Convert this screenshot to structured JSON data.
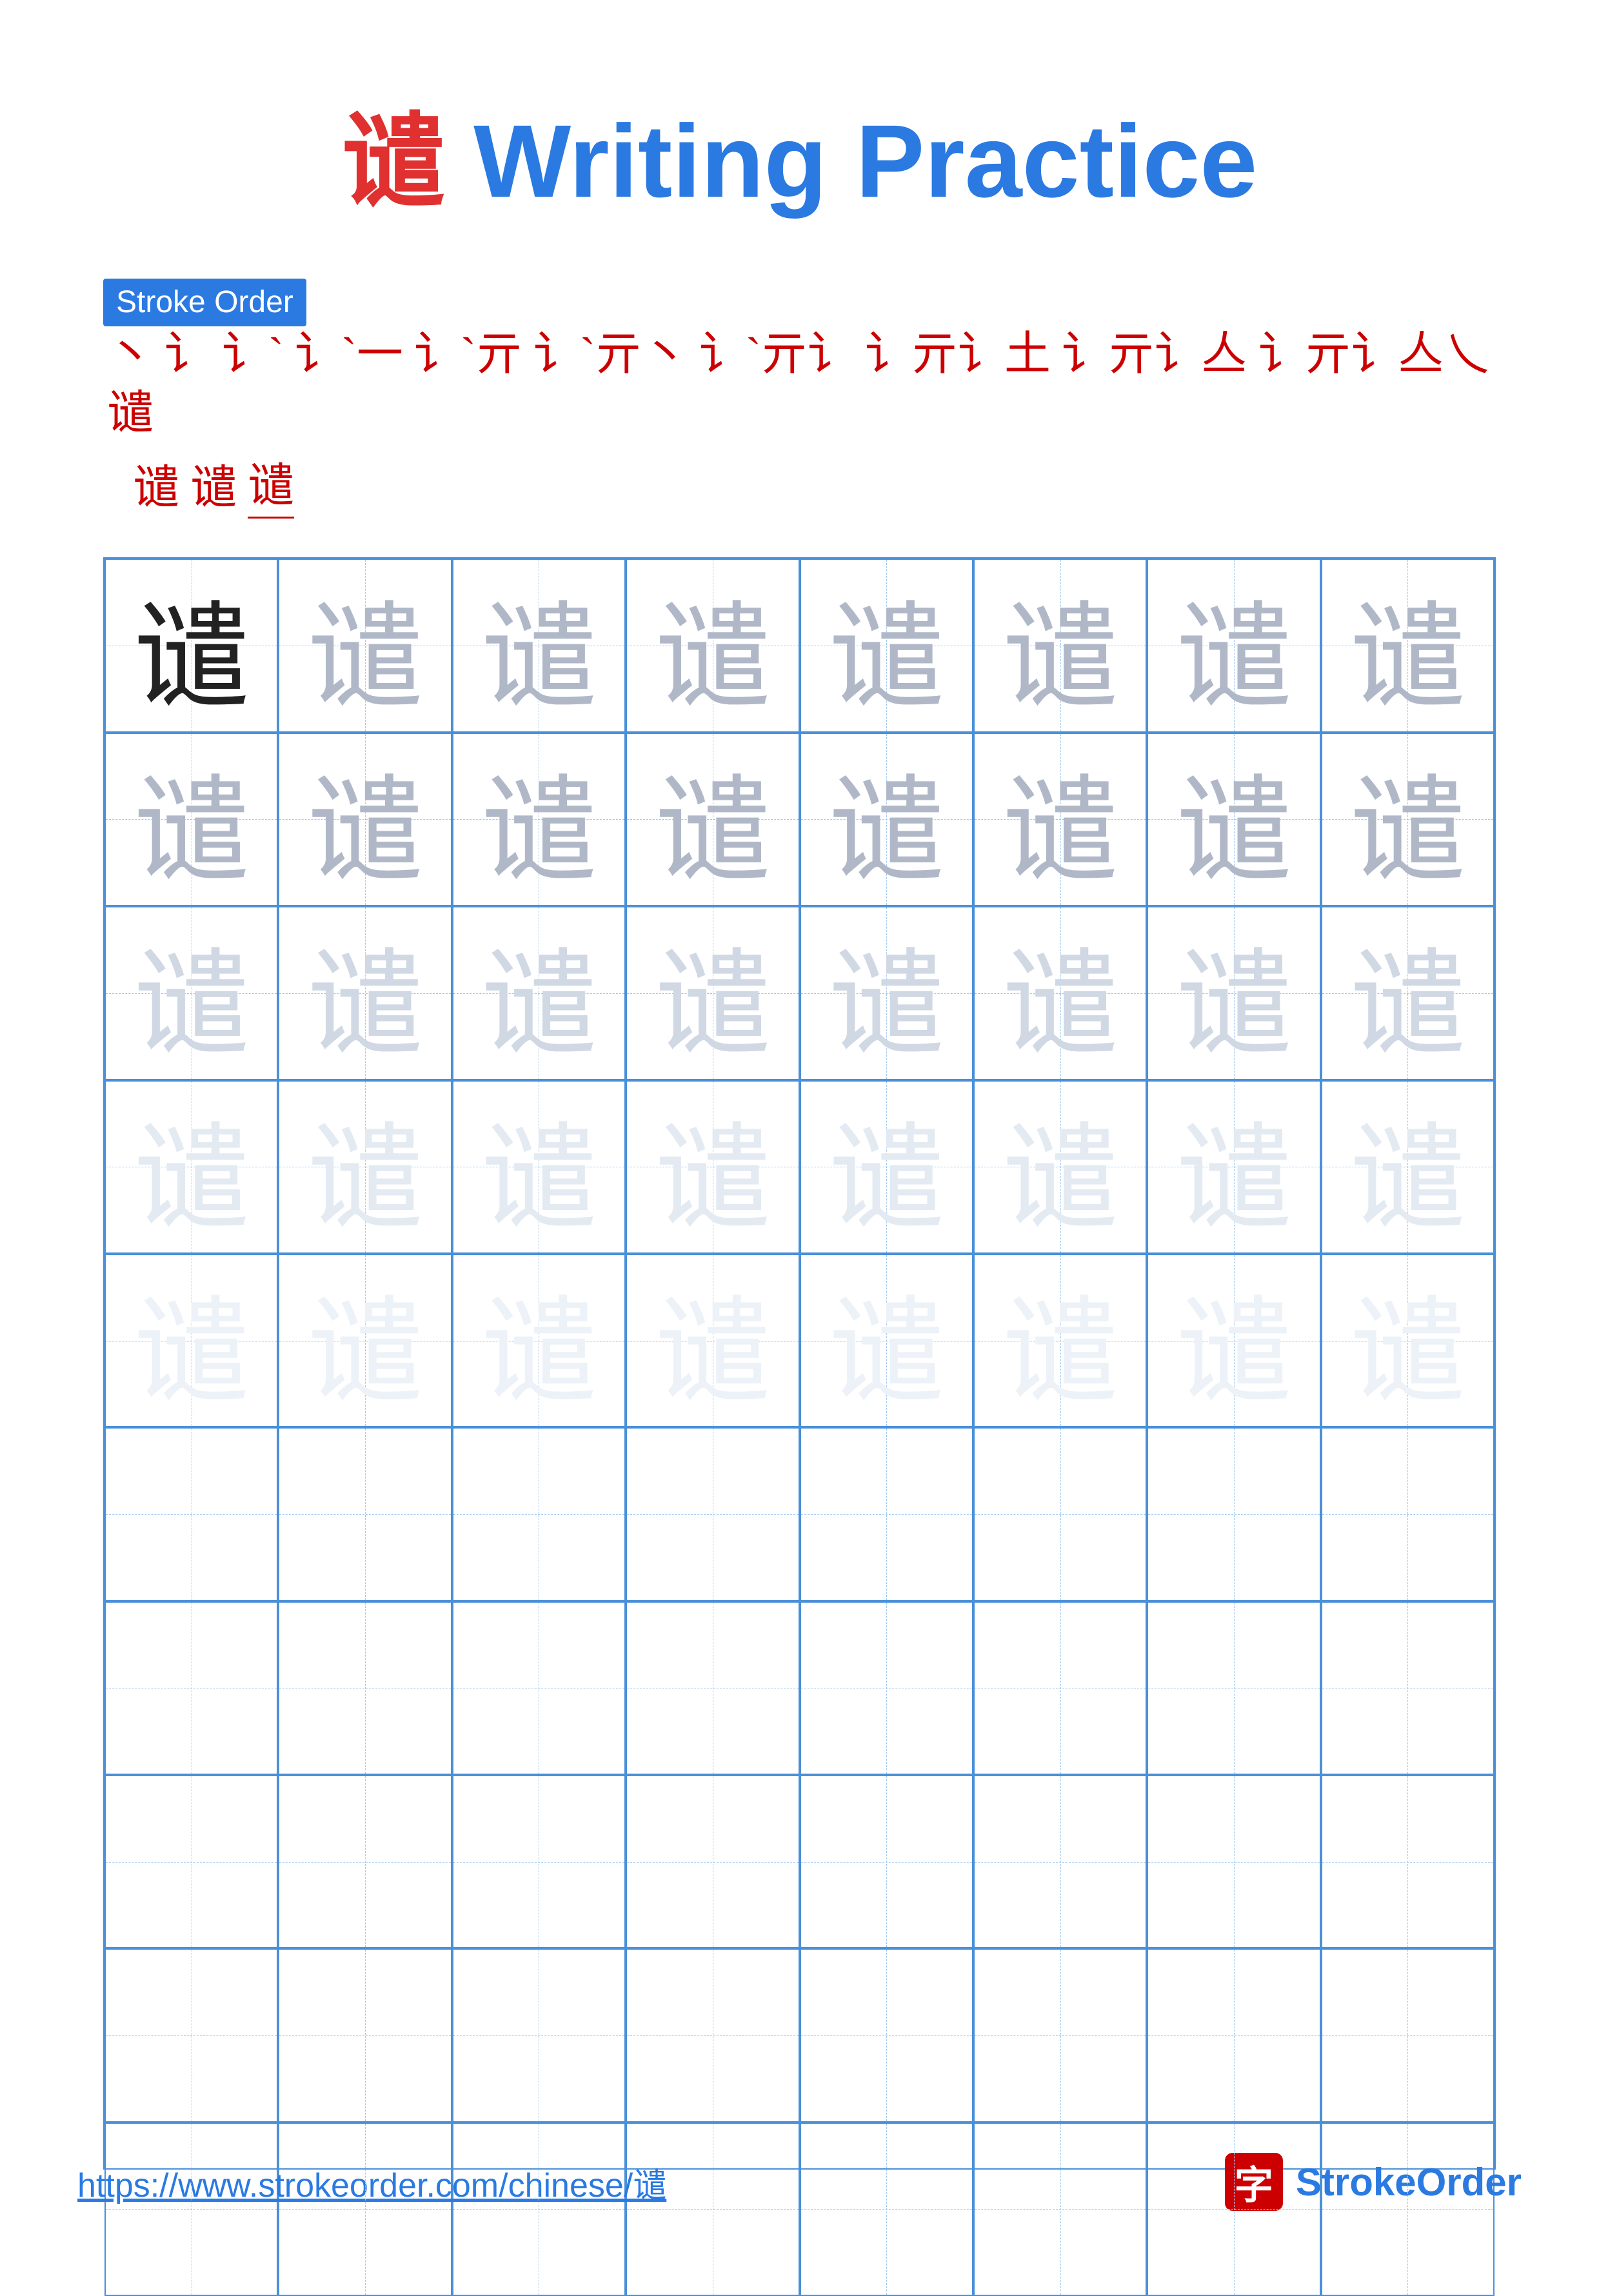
{
  "title": {
    "char": "谴",
    "rest": " Writing Practice"
  },
  "stroke_order": {
    "label": "Stroke Order",
    "strokes": [
      "丶",
      "讠",
      "讠̀",
      "讠̀一",
      "讠̀亓",
      "讠̀亓丶",
      "讠̀亓讠",
      "讠̀亓讠土",
      "讠̀亓讠亼",
      "讠̀亓讠亼乀",
      "谴",
      "谴谴",
      "谴谴谴"
    ],
    "stroke_chars_line1": [
      "丶",
      "讠",
      "讠`",
      "讠`一",
      "讠亓",
      "讠亓丶",
      "讠亓讠",
      "讠亓讠土",
      "讠亓讠亼",
      "讠亓讠亼乀",
      "谴"
    ],
    "stroke_chars_line2": [
      "谴",
      "谴",
      "谴"
    ]
  },
  "grid": {
    "rows": 10,
    "cols": 8,
    "char": "谴",
    "filled_rows": 5,
    "practice_rows": 5
  },
  "footer": {
    "url": "https://www.strokeorder.com/chinese/谴",
    "logo_char": "字",
    "logo_text_stroke": "Stroke",
    "logo_text_order": "Order"
  },
  "colors": {
    "blue": "#2a7ae2",
    "red": "#cc0000",
    "char_dark": "#222222",
    "char_medium": "#b0b8c8",
    "char_light": "#d0d8e4",
    "char_very_light": "#e4eaf2",
    "grid_border": "#4a90d9",
    "grid_dashed": "#9dc8f0"
  }
}
